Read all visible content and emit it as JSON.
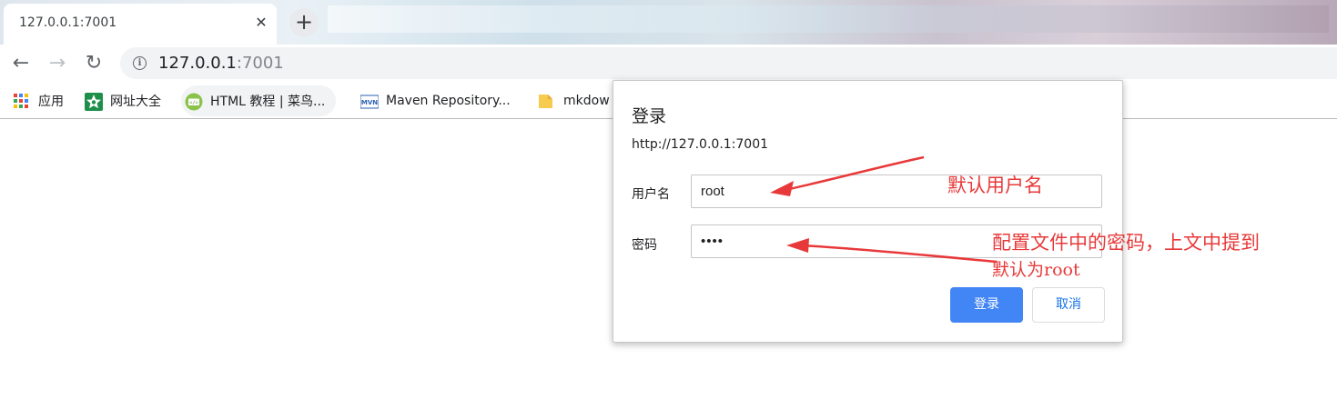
{
  "tab": {
    "title": "127.0.0.1:7001"
  },
  "toolbar": {
    "url_host": "127.0.0.1",
    "url_port": ":7001"
  },
  "bookmarks": [
    {
      "label": "应用",
      "icon": "apps-grid-icon"
    },
    {
      "label": "网址大全",
      "icon": "site-directory-icon"
    },
    {
      "label": "HTML 教程 | 菜鸟...",
      "icon": "runoob-icon"
    },
    {
      "label": "Maven Repository...",
      "icon": "mvn-icon"
    },
    {
      "label": "mkdow",
      "icon": "folder-icon"
    }
  ],
  "dialog": {
    "title": "登录",
    "origin": "http://127.0.0.1:7001",
    "username_label": "用户名",
    "username_value": "root",
    "password_label": "密码",
    "password_value": "root",
    "ok_label": "登录",
    "cancel_label": "取消"
  },
  "annotations": {
    "username_note": "默认用户名",
    "password_note_line1": "配置文件中的密码，上文中提到",
    "password_note_line2": "默认为root"
  },
  "colors": {
    "primary_button": "#4285f4",
    "annotation_red": "#e8393a"
  }
}
